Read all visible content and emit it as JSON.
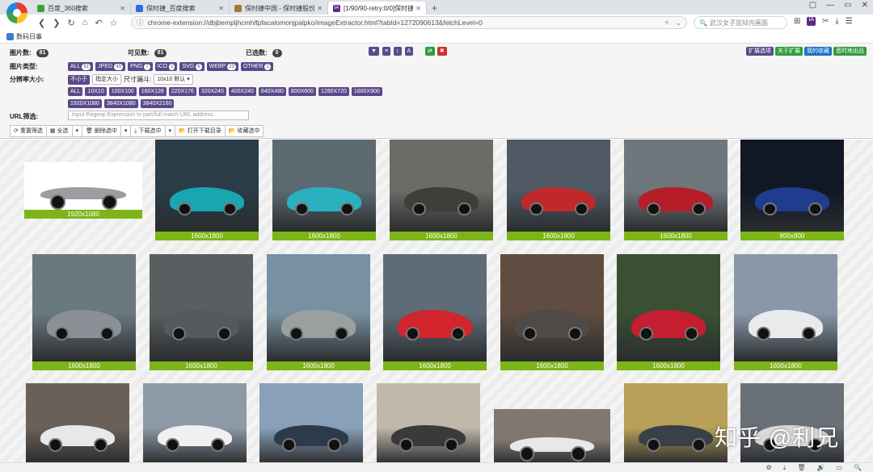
{
  "tabs": [
    {
      "title": "百度_360搜索",
      "color": "#3ca03c"
    },
    {
      "title": "保时捷_百度搜索",
      "color": "#2e6be6"
    },
    {
      "title": "保时捷中国 - 保时捷股份公司",
      "color": "#a0783c"
    },
    {
      "title": "[1/90/90-retry:0/0]保时捷",
      "color": "#5b2a86",
      "icon_text": "IA"
    }
  ],
  "tab_icons": {
    "close": "✕",
    "new_tab": "+"
  },
  "window_controls": [
    "▢",
    "—",
    "▭",
    "✕"
  ],
  "nav": {
    "back": "❮",
    "forward": "❯",
    "reload": "↻",
    "home": "⌂",
    "undo": "↶",
    "star": "☆"
  },
  "address": {
    "security_icon": "ⓘ",
    "url": "chrome-extension://dbjbempljhcmhlfpfacalomonjpalpko/imageExtractor.html?tabId=1272090613&fetchLevel=0",
    "right_icons": [
      "⚡",
      "⌄"
    ]
  },
  "search": {
    "placeholder": "武汉女子监狱内画面",
    "icon": "🔍"
  },
  "toolbar_icons": [
    "⊞",
    "IA",
    "✂",
    "⤓",
    "☰"
  ],
  "bookmarks": [
    {
      "label": "数码日事"
    }
  ],
  "stats": {
    "images_label": "图片数:",
    "images_count": "81",
    "visible_label": "可见数:",
    "visible_count": "81",
    "selected_label": "已选数:",
    "selected_count": "0"
  },
  "view_buttons": [
    "▼",
    "≡",
    "↕",
    "A"
  ],
  "action_buttons": [
    {
      "label": "⇄",
      "color": "#2e9c3c"
    },
    {
      "label": "✖",
      "color": "#d32f2f"
    }
  ],
  "top_right_buttons": [
    {
      "label": "扩展选项",
      "color": "#5b4a8a"
    },
    {
      "label": "关于扩展",
      "color": "#2e9c3c"
    },
    {
      "label": "我的收藏",
      "color": "#1e6fc4"
    },
    {
      "label": "音时地出品",
      "color": "#2e9c3c"
    }
  ],
  "types": {
    "label": "图片类型:",
    "items": [
      {
        "name": "ALL",
        "count": "81"
      },
      {
        "name": "JPEG",
        "count": "45"
      },
      {
        "name": "PNG",
        "count": "7"
      },
      {
        "name": "ICO",
        "count": "1"
      },
      {
        "name": "SVG",
        "count": "6"
      },
      {
        "name": "WEBP",
        "count": "23"
      },
      {
        "name": "OTHER",
        "count": "1"
      }
    ]
  },
  "resolution": {
    "label": "分辨率大小:",
    "min_label": "不小于",
    "exact_label": "指定大小",
    "size_filter_label": "尺寸漏斗:",
    "size_select": "10x10 默认",
    "row1": [
      "ALL",
      "10X10",
      "100X100",
      "160X128",
      "220X176",
      "320X240",
      "400X240",
      "640X480",
      "800X600",
      "1280X720",
      "1600X900"
    ],
    "row2": [
      "1920X1080",
      "3840X1080",
      "3840X2160"
    ]
  },
  "url_filter": {
    "label": "URL筛选:",
    "placeholder": "Input Regexp Expression to part/full match URL address."
  },
  "actionbar": [
    {
      "icon": "⟳",
      "label": "重置筛选"
    },
    {
      "icon": "▦",
      "label": "全选"
    },
    {
      "icon": "▾",
      "label": ""
    },
    {
      "icon": "🗑",
      "label": "删除选中"
    },
    {
      "icon": "▾",
      "label": ""
    },
    {
      "icon": "⤓",
      "label": "下载选中"
    },
    {
      "icon": "▾",
      "label": ""
    },
    {
      "icon": "📂",
      "label": "打开下载目录"
    },
    {
      "icon": "📂",
      "label": "收藏选中"
    }
  ],
  "gallery": [
    {
      "caption": "1920x1080",
      "bg": "#ffffff",
      "car": "#9a9ea3"
    },
    {
      "caption": "1600x1800",
      "bg": "#2a3c48",
      "car": "#1aa5b0"
    },
    {
      "caption": "1600x1800",
      "bg": "#5a6a70",
      "car": "#2bb0c0"
    },
    {
      "caption": "1600x1800",
      "bg": "#6a6c66",
      "car": "#3c4038"
    },
    {
      "caption": "1600x1800",
      "bg": "#4f5a64",
      "car": "#c0282c"
    },
    {
      "caption": "1600x1800",
      "bg": "#6f767c",
      "car": "#b51e28"
    },
    {
      "caption": "800x900",
      "bg": "#101826",
      "car": "#1f3c8e"
    },
    {
      "caption": "1600x1800",
      "bg": "#6a7880",
      "car": "#8a9096"
    },
    {
      "caption": "1600x1800",
      "bg": "#5a5e60",
      "car": "#55595c"
    },
    {
      "caption": "1600x1800",
      "bg": "#7890a0",
      "car": "#9aa0a0"
    },
    {
      "caption": "1600x1800",
      "bg": "#5e6c78",
      "car": "#d2242c"
    },
    {
      "caption": "1600x1800",
      "bg": "#604c40",
      "car": "#4e4a46"
    },
    {
      "caption": "1600x1800",
      "bg": "#3a5034",
      "car": "#c41e30"
    },
    {
      "caption": "1600x1800",
      "bg": "#8898a8",
      "car": "#e8eaec"
    },
    {
      "caption": "",
      "bg": "#6a6058",
      "car": "#e6e8ea"
    },
    {
      "caption": "",
      "bg": "#8c9aa8",
      "car": "#f0f0f0"
    },
    {
      "caption": "",
      "bg": "#88a0b8",
      "car": "#2c3a4c"
    },
    {
      "caption": "",
      "bg": "#c0b8a8",
      "car": "#3a3a3a"
    },
    {
      "caption": "",
      "bg": "#807870",
      "car": "#e8e8e8"
    },
    {
      "caption": "",
      "bg": "#b8a058",
      "car": "#3a4048"
    },
    {
      "caption": "",
      "bg": "#6a7078",
      "car": "#d8d8d8"
    }
  ],
  "watermark": "知乎 @利兄",
  "status_icons": [
    "⚙",
    "⤓",
    "🗑",
    "🔊",
    "▭",
    "🔍"
  ]
}
